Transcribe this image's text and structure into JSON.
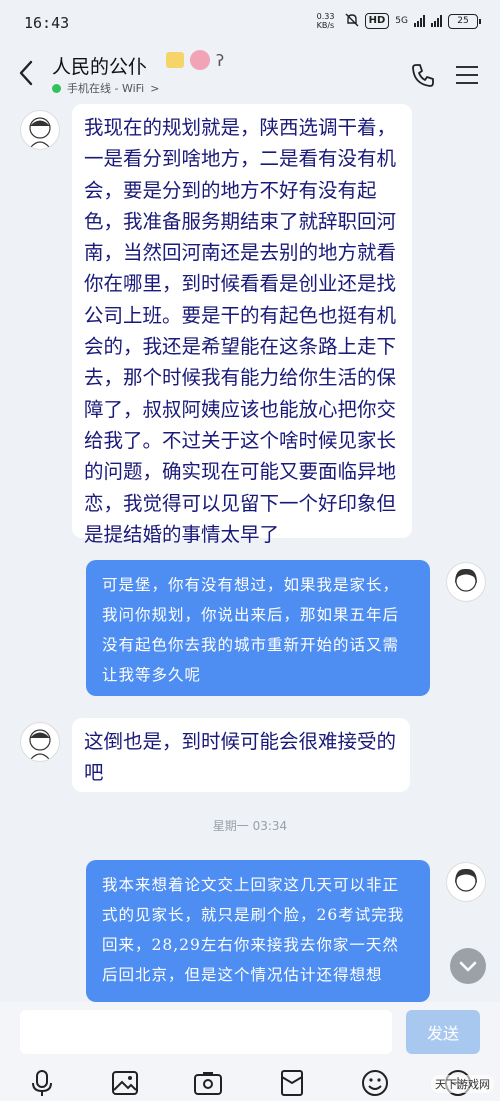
{
  "status": {
    "time": "16:43",
    "speed": "0.33 KB/s",
    "hd": "HD",
    "network": "5G",
    "battery": "25"
  },
  "header": {
    "title": "人民的公仆",
    "subtitle": "手机在线 - WiFi",
    "subtitle_arrow": ">"
  },
  "messages": {
    "m1": "我现在的规划就是，陕西选调干着，一是看分到啥地方，二是看有没有机会，要是分到的地方不好有没有起色，我准备服务期结束了就辞职回河南，当然回河南还是去别的地方就看你在哪里，到时候看看是创业还是找公司上班。要是干的有起色也挺有机会的，我还是希望能在这条路上走下去，那个时候我有能力给你生活的保障了，叔叔阿姨应该也能放心把你交给我了。不过关于这个啥时候见家长的问题，确实现在可能又要面临异地恋，我觉得可以见留下一个好印象但是提结婚的事情太早了",
    "m2": "可是堡，你有没有想过，如果我是家长，我问你规划，你说出来后，那如果五年后没有起色你去我的城市重新开始的话又需让我等多久呢",
    "m3": "这倒也是，到时候可能会很难接受的吧",
    "timestamp": "星期一 03:34",
    "m4": "我本来想着论文交上回家这几天可以非正式的见家长，就只是刷个脸，26考试完我回来，28,29左右你来接我去你家一天然后回北京，但是这个情况估计还得想想"
  },
  "input": {
    "placeholder": "",
    "send_label": "发送"
  },
  "watermark": "天下游戏网",
  "colors": {
    "outgoing_bubble": "#4e8ef3",
    "incoming_text": "#1a1a7a",
    "send_button": "#a8c8ef",
    "online_dot": "#32c15b"
  }
}
